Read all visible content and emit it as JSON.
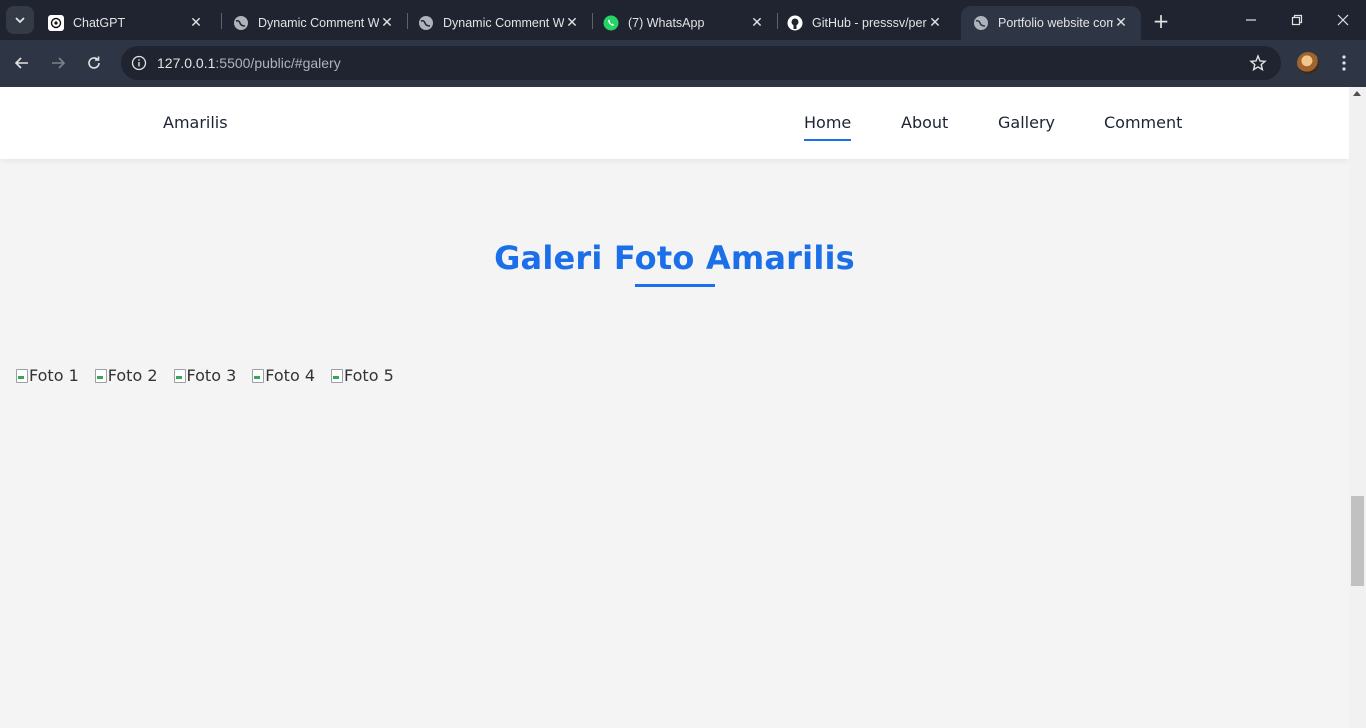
{
  "browser": {
    "tabs": [
      {
        "title": "ChatGPT",
        "icon": "chatgpt-icon",
        "active": false
      },
      {
        "title": "Dynamic Comment W",
        "icon": "globe-icon",
        "active": false
      },
      {
        "title": "Dynamic Comment W",
        "icon": "globe-icon",
        "active": false
      },
      {
        "title": "(7) WhatsApp",
        "icon": "whatsapp-icon",
        "active": false
      },
      {
        "title": "GitHub - presssv/per",
        "icon": "github-icon",
        "active": false
      },
      {
        "title": "Portfolio website com",
        "icon": "globe-icon",
        "active": true
      }
    ],
    "url_host": "127.0.0.1",
    "url_rest": ":5500/public/#galery",
    "colors": {
      "chrome_dark": "#1f2430",
      "chrome_toolbar": "#2e3545",
      "accent": "#1b6fe8"
    }
  },
  "site": {
    "brand": "Amarilis",
    "nav": [
      {
        "label": "Home",
        "active": true
      },
      {
        "label": "About",
        "active": false
      },
      {
        "label": "Gallery",
        "active": false
      },
      {
        "label": "Comment",
        "active": false
      }
    ],
    "gallery": {
      "title": "Galeri Foto Amarilis",
      "photos": [
        "Foto 1",
        "Foto 2",
        "Foto 3",
        "Foto 4",
        "Foto 5"
      ]
    }
  }
}
